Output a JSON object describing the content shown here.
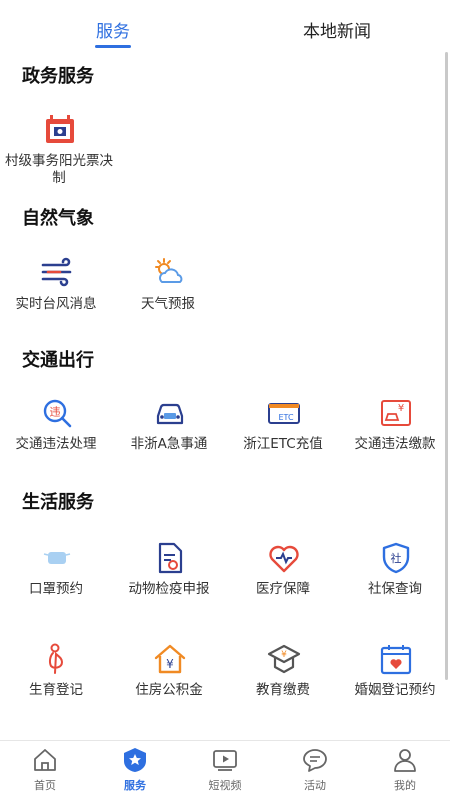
{
  "tabs": {
    "services": "服务",
    "news": "本地新闻"
  },
  "sections": {
    "gov": {
      "title": "政务服务",
      "items": [
        {
          "label": "村级事务阳光票决制",
          "icon": "village-vote-icon"
        }
      ]
    },
    "weather": {
      "title": "自然气象",
      "items": [
        {
          "label": "实时台风消息",
          "icon": "typhoon-wind-icon"
        },
        {
          "label": "天气预报",
          "icon": "sun-cloud-icon"
        }
      ]
    },
    "traffic": {
      "title": "交通出行",
      "items": [
        {
          "label": "交通违法处理",
          "icon": "violation-search-icon"
        },
        {
          "label": "非浙A急事通",
          "icon": "car-icon"
        },
        {
          "label": "浙江ETC充值",
          "icon": "etc-card-icon"
        },
        {
          "label": "交通违法缴款",
          "icon": "payment-car-icon"
        }
      ]
    },
    "life": {
      "title": "生活服务",
      "items": [
        {
          "label": "口罩预约",
          "icon": "mask-icon"
        },
        {
          "label": "动物检疫申报",
          "icon": "document-icon"
        },
        {
          "label": "医疗保障",
          "icon": "heart-medical-icon"
        },
        {
          "label": "社保查询",
          "icon": "social-security-shield-icon"
        },
        {
          "label": "生育登记",
          "icon": "pregnancy-icon"
        },
        {
          "label": "住房公积金",
          "icon": "house-yen-icon"
        },
        {
          "label": "教育缴费",
          "icon": "mortarboard-yen-icon"
        },
        {
          "label": "婚姻登记预约",
          "icon": "calendar-heart-icon"
        }
      ]
    }
  },
  "bottom_nav": [
    {
      "label": "首页",
      "icon": "home-icon"
    },
    {
      "label": "服务",
      "icon": "star-badge-icon"
    },
    {
      "label": "短视频",
      "icon": "video-play-icon"
    },
    {
      "label": "活动",
      "icon": "chat-bubble-icon"
    },
    {
      "label": "我的",
      "icon": "user-icon"
    }
  ],
  "colors": {
    "accent": "#2e6fe0",
    "red": "#e64a3b",
    "orange": "#f08a24",
    "navy": "#2b3f8f"
  }
}
